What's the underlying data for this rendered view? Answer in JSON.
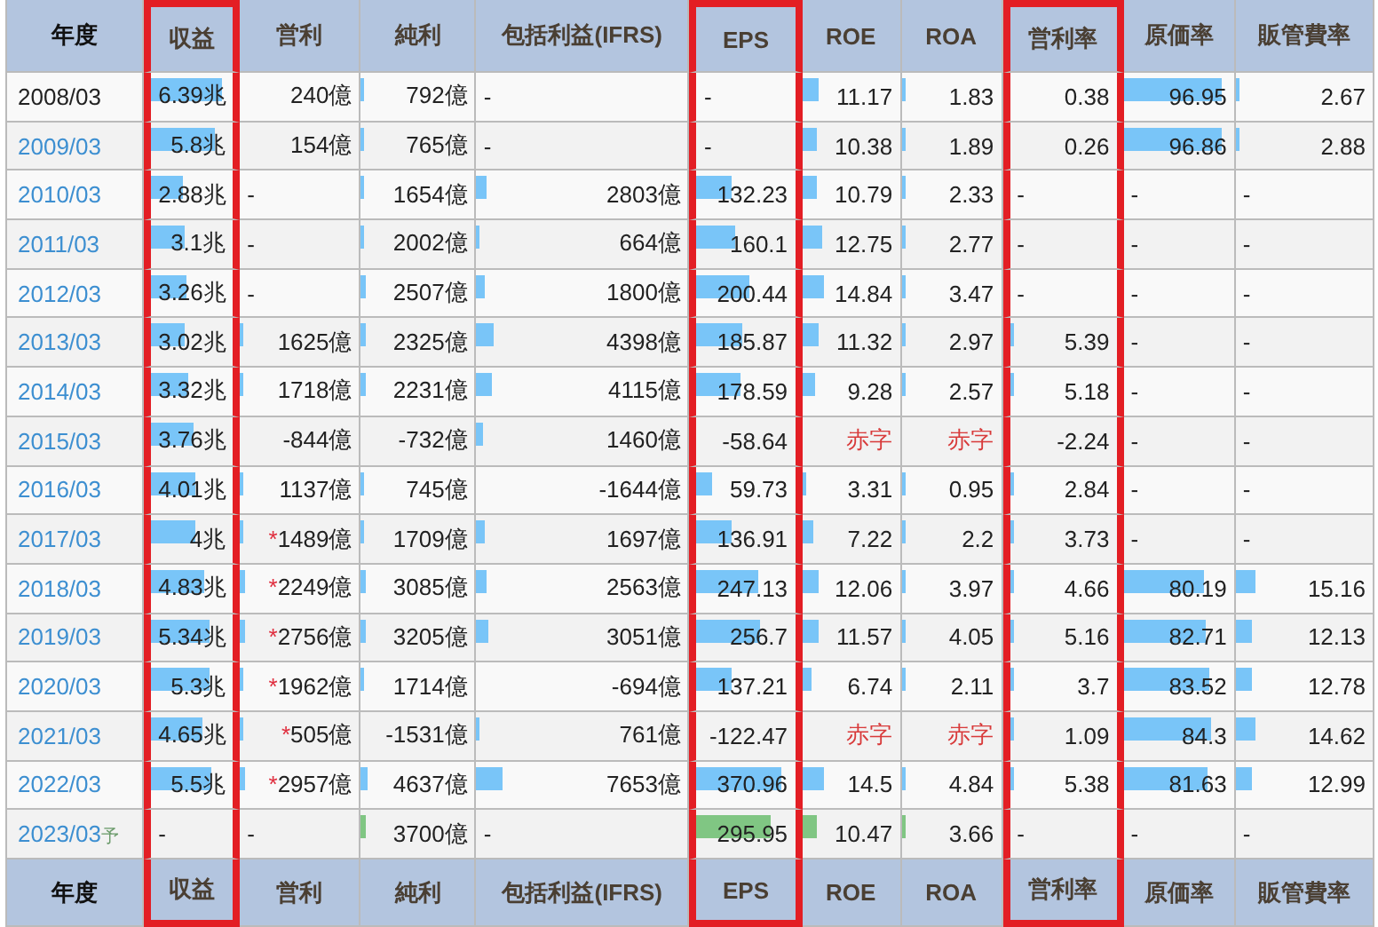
{
  "columns": [
    {
      "label": "年度",
      "highlighted": false
    },
    {
      "label": "収益",
      "highlighted": true
    },
    {
      "label": "営利",
      "highlighted": false
    },
    {
      "label": "純利",
      "highlighted": false
    },
    {
      "label": "包括利益(IFRS)",
      "highlighted": false
    },
    {
      "label": "EPS",
      "highlighted": true
    },
    {
      "label": "ROE",
      "highlighted": false
    },
    {
      "label": "ROA",
      "highlighted": false
    },
    {
      "label": "営利率",
      "highlighted": true
    },
    {
      "label": "原価率",
      "highlighted": false
    },
    {
      "label": "販管費率",
      "highlighted": false
    }
  ],
  "rows": [
    {
      "year": "2008/03",
      "link": false,
      "forecast": false,
      "cells": [
        {
          "kind": "value",
          "text": "6.39兆",
          "level": 0.86
        },
        {
          "kind": "value",
          "text": "240億"
        },
        {
          "kind": "value",
          "text": "792億",
          "level": 0.02
        },
        {
          "kind": "none",
          "text": "-"
        },
        {
          "kind": "none",
          "text": "-"
        },
        {
          "kind": "value",
          "text": "11.17",
          "level": 0.17
        },
        {
          "kind": "value",
          "text": "1.83",
          "level": 0.04
        },
        {
          "kind": "value",
          "text": "0.38"
        },
        {
          "kind": "value",
          "text": "96.95",
          "level": 0.89
        },
        {
          "kind": "value",
          "text": "2.67",
          "level": 0.03
        }
      ]
    },
    {
      "year": "2009/03",
      "link": true,
      "forecast": false,
      "cells": [
        {
          "kind": "value",
          "text": "5.8兆",
          "level": 0.78
        },
        {
          "kind": "value",
          "text": "154億"
        },
        {
          "kind": "value",
          "text": "765億",
          "level": 0.02
        },
        {
          "kind": "none",
          "text": "-"
        },
        {
          "kind": "none",
          "text": "-"
        },
        {
          "kind": "value",
          "text": "10.38",
          "level": 0.16
        },
        {
          "kind": "value",
          "text": "1.89",
          "level": 0.04
        },
        {
          "kind": "value",
          "text": "0.26"
        },
        {
          "kind": "value",
          "text": "96.86",
          "level": 0.89
        },
        {
          "kind": "value",
          "text": "2.88",
          "level": 0.03
        }
      ]
    },
    {
      "year": "2010/03",
      "link": true,
      "forecast": false,
      "cells": [
        {
          "kind": "value",
          "text": "2.88兆",
          "level": 0.39
        },
        {
          "kind": "none",
          "text": "-"
        },
        {
          "kind": "value",
          "text": "1654億",
          "level": 0.03
        },
        {
          "kind": "value",
          "text": "2803億",
          "level": 0.05
        },
        {
          "kind": "value",
          "text": "132.23",
          "level": 0.35
        },
        {
          "kind": "value",
          "text": "10.79",
          "level": 0.16
        },
        {
          "kind": "value",
          "text": "2.33",
          "level": 0.04
        },
        {
          "kind": "none",
          "text": "-"
        },
        {
          "kind": "none",
          "text": "-"
        },
        {
          "kind": "none",
          "text": "-"
        }
      ]
    },
    {
      "year": "2011/03",
      "link": true,
      "forecast": false,
      "cells": [
        {
          "kind": "value",
          "text": "3.1兆",
          "level": 0.42
        },
        {
          "kind": "none",
          "text": "-"
        },
        {
          "kind": "value",
          "text": "2002億",
          "level": 0.03
        },
        {
          "kind": "value",
          "text": "664億",
          "level": 0.01
        },
        {
          "kind": "value",
          "text": "160.1",
          "level": 0.4
        },
        {
          "kind": "value",
          "text": "12.75",
          "level": 0.2
        },
        {
          "kind": "value",
          "text": "2.77",
          "level": 0.04
        },
        {
          "kind": "none",
          "text": "-"
        },
        {
          "kind": "none",
          "text": "-"
        },
        {
          "kind": "none",
          "text": "-"
        }
      ]
    },
    {
      "year": "2012/03",
      "link": true,
      "forecast": false,
      "cells": [
        {
          "kind": "value",
          "text": "3.26兆",
          "level": 0.44
        },
        {
          "kind": "none",
          "text": "-"
        },
        {
          "kind": "value",
          "text": "2507億",
          "level": 0.04
        },
        {
          "kind": "value",
          "text": "1800億",
          "level": 0.04
        },
        {
          "kind": "value",
          "text": "200.44",
          "level": 0.53
        },
        {
          "kind": "value",
          "text": "14.84",
          "level": 0.23
        },
        {
          "kind": "value",
          "text": "3.47",
          "level": 0.04
        },
        {
          "kind": "none",
          "text": "-"
        },
        {
          "kind": "none",
          "text": "-"
        },
        {
          "kind": "none",
          "text": "-"
        }
      ]
    },
    {
      "year": "2013/03",
      "link": true,
      "forecast": false,
      "cells": [
        {
          "kind": "value",
          "text": "3.02兆",
          "level": 0.41
        },
        {
          "kind": "value",
          "text": "1625億",
          "level": 0.03
        },
        {
          "kind": "value",
          "text": "2325億",
          "level": 0.04
        },
        {
          "kind": "value",
          "text": "4398億",
          "level": 0.08
        },
        {
          "kind": "value",
          "text": "185.87",
          "level": 0.47
        },
        {
          "kind": "value",
          "text": "11.32",
          "level": 0.17
        },
        {
          "kind": "value",
          "text": "2.97",
          "level": 0.04
        },
        {
          "kind": "value",
          "text": "5.39",
          "level": 0.04
        },
        {
          "kind": "none",
          "text": "-"
        },
        {
          "kind": "none",
          "text": "-"
        }
      ]
    },
    {
      "year": "2014/03",
      "link": true,
      "forecast": false,
      "cells": [
        {
          "kind": "value",
          "text": "3.32兆",
          "level": 0.45
        },
        {
          "kind": "value",
          "text": "1718億",
          "level": 0.03
        },
        {
          "kind": "value",
          "text": "2231億",
          "level": 0.04
        },
        {
          "kind": "value",
          "text": "4115億",
          "level": 0.07
        },
        {
          "kind": "value",
          "text": "178.59",
          "level": 0.45
        },
        {
          "kind": "value",
          "text": "9.28",
          "level": 0.14
        },
        {
          "kind": "value",
          "text": "2.57",
          "level": 0.04
        },
        {
          "kind": "value",
          "text": "5.18",
          "level": 0.04
        },
        {
          "kind": "none",
          "text": "-"
        },
        {
          "kind": "none",
          "text": "-"
        }
      ]
    },
    {
      "year": "2015/03",
      "link": true,
      "forecast": false,
      "cells": [
        {
          "kind": "value",
          "text": "3.76兆",
          "level": 0.51
        },
        {
          "kind": "value",
          "text": "-844億"
        },
        {
          "kind": "value",
          "text": "-732億"
        },
        {
          "kind": "value",
          "text": "1460億",
          "level": 0.03
        },
        {
          "kind": "value",
          "text": "-58.64"
        },
        {
          "kind": "loss",
          "text": "赤字"
        },
        {
          "kind": "loss",
          "text": "赤字"
        },
        {
          "kind": "value",
          "text": "-2.24"
        },
        {
          "kind": "none",
          "text": "-"
        },
        {
          "kind": "none",
          "text": "-"
        }
      ]
    },
    {
      "year": "2016/03",
      "link": true,
      "forecast": false,
      "cells": [
        {
          "kind": "value",
          "text": "4.01兆",
          "level": 0.54
        },
        {
          "kind": "value",
          "text": "1137億",
          "level": 0.02
        },
        {
          "kind": "value",
          "text": "745億",
          "level": 0.02
        },
        {
          "kind": "value",
          "text": "-1644億"
        },
        {
          "kind": "value",
          "text": "59.73",
          "level": 0.15
        },
        {
          "kind": "value",
          "text": "3.31",
          "level": 0.05
        },
        {
          "kind": "value",
          "text": "0.95",
          "level": 0.02
        },
        {
          "kind": "value",
          "text": "2.84",
          "level": 0.04
        },
        {
          "kind": "none",
          "text": "-"
        },
        {
          "kind": "none",
          "text": "-"
        }
      ]
    },
    {
      "year": "2017/03",
      "link": true,
      "forecast": false,
      "cells": [
        {
          "kind": "value",
          "text": "4兆",
          "level": 0.54
        },
        {
          "kind": "value",
          "text": "1489億",
          "level": 0.03,
          "flag": "*"
        },
        {
          "kind": "value",
          "text": "1709億",
          "level": 0.03
        },
        {
          "kind": "value",
          "text": "1697億",
          "level": 0.04
        },
        {
          "kind": "value",
          "text": "136.91",
          "level": 0.35
        },
        {
          "kind": "value",
          "text": "7.22",
          "level": 0.11
        },
        {
          "kind": "value",
          "text": "2.2",
          "level": 0.04
        },
        {
          "kind": "value",
          "text": "3.73",
          "level": 0.04
        },
        {
          "kind": "none",
          "text": "-"
        },
        {
          "kind": "none",
          "text": "-"
        }
      ]
    },
    {
      "year": "2018/03",
      "link": true,
      "forecast": false,
      "cells": [
        {
          "kind": "value",
          "text": "4.83兆",
          "level": 0.65
        },
        {
          "kind": "value",
          "text": "2249億",
          "level": 0.04,
          "flag": "*"
        },
        {
          "kind": "value",
          "text": "3085億",
          "level": 0.05
        },
        {
          "kind": "value",
          "text": "2563億",
          "level": 0.05
        },
        {
          "kind": "value",
          "text": "247.13",
          "level": 0.63
        },
        {
          "kind": "value",
          "text": "12.06",
          "level": 0.18
        },
        {
          "kind": "value",
          "text": "3.97",
          "level": 0.04
        },
        {
          "kind": "value",
          "text": "4.66",
          "level": 0.04
        },
        {
          "kind": "value",
          "text": "80.19",
          "level": 0.73
        },
        {
          "kind": "value",
          "text": "15.16",
          "level": 0.14
        }
      ]
    },
    {
      "year": "2019/03",
      "link": true,
      "forecast": false,
      "cells": [
        {
          "kind": "value",
          "text": "5.34兆",
          "level": 0.72
        },
        {
          "kind": "value",
          "text": "2756億",
          "level": 0.04,
          "flag": "*"
        },
        {
          "kind": "value",
          "text": "3205億",
          "level": 0.05
        },
        {
          "kind": "value",
          "text": "3051億",
          "level": 0.06
        },
        {
          "kind": "value",
          "text": "256.7",
          "level": 0.65
        },
        {
          "kind": "value",
          "text": "11.57",
          "level": 0.18
        },
        {
          "kind": "value",
          "text": "4.05",
          "level": 0.04
        },
        {
          "kind": "value",
          "text": "5.16",
          "level": 0.04
        },
        {
          "kind": "value",
          "text": "82.71",
          "level": 0.75
        },
        {
          "kind": "value",
          "text": "12.13",
          "level": 0.12
        }
      ]
    },
    {
      "year": "2020/03",
      "link": true,
      "forecast": false,
      "cells": [
        {
          "kind": "value",
          "text": "5.3兆",
          "level": 0.72
        },
        {
          "kind": "value",
          "text": "1962億",
          "level": 0.03,
          "flag": "*"
        },
        {
          "kind": "value",
          "text": "1714億",
          "level": 0.03
        },
        {
          "kind": "value",
          "text": "-694億"
        },
        {
          "kind": "value",
          "text": "137.21",
          "level": 0.35
        },
        {
          "kind": "value",
          "text": "6.74",
          "level": 0.1
        },
        {
          "kind": "value",
          "text": "2.11",
          "level": 0.04
        },
        {
          "kind": "value",
          "text": "3.7",
          "level": 0.04
        },
        {
          "kind": "value",
          "text": "83.52",
          "level": 0.77
        },
        {
          "kind": "value",
          "text": "12.78",
          "level": 0.12
        }
      ]
    },
    {
      "year": "2021/03",
      "link": true,
      "forecast": false,
      "cells": [
        {
          "kind": "value",
          "text": "4.65兆",
          "level": 0.63
        },
        {
          "kind": "value",
          "text": "505億",
          "level": 0.01,
          "flag": "*"
        },
        {
          "kind": "value",
          "text": "-1531億"
        },
        {
          "kind": "value",
          "text": "761億",
          "level": 0.01
        },
        {
          "kind": "value",
          "text": "-122.47"
        },
        {
          "kind": "loss",
          "text": "赤字"
        },
        {
          "kind": "loss",
          "text": "赤字"
        },
        {
          "kind": "value",
          "text": "1.09",
          "level": 0.01
        },
        {
          "kind": "value",
          "text": "84.3",
          "level": 0.8
        },
        {
          "kind": "value",
          "text": "14.62",
          "level": 0.14
        }
      ]
    },
    {
      "year": "2022/03",
      "link": true,
      "forecast": false,
      "cells": [
        {
          "kind": "value",
          "text": "5.5兆",
          "level": 0.74
        },
        {
          "kind": "value",
          "text": "2957億",
          "level": 0.04,
          "flag": "*"
        },
        {
          "kind": "value",
          "text": "4637億",
          "level": 0.06
        },
        {
          "kind": "value",
          "text": "7653億",
          "level": 0.12
        },
        {
          "kind": "value",
          "text": "370.96",
          "level": 0.87
        },
        {
          "kind": "value",
          "text": "14.5",
          "level": 0.22
        },
        {
          "kind": "value",
          "text": "4.84",
          "level": 0.04
        },
        {
          "kind": "value",
          "text": "5.38",
          "level": 0.04
        },
        {
          "kind": "value",
          "text": "81.63",
          "level": 0.76
        },
        {
          "kind": "value",
          "text": "12.99",
          "level": 0.12
        }
      ]
    },
    {
      "year": "2023/03",
      "link": true,
      "forecast": true,
      "suffix": "予",
      "cells": [
        {
          "kind": "none",
          "text": "-"
        },
        {
          "kind": "none",
          "text": "-"
        },
        {
          "kind": "value",
          "text": "3700億",
          "level": 0.04
        },
        {
          "kind": "none",
          "text": "-"
        },
        {
          "kind": "value",
          "text": "295.95",
          "level": 0.75
        },
        {
          "kind": "value",
          "text": "10.47",
          "level": 0.16
        },
        {
          "kind": "value",
          "text": "3.66",
          "level": 0.04
        },
        {
          "kind": "none",
          "text": "-"
        },
        {
          "kind": "none",
          "text": "-"
        },
        {
          "kind": "none",
          "text": "-"
        }
      ]
    }
  ],
  "footer": [
    "年度",
    "収益",
    "営利",
    "純利",
    "包括利益(IFRS)",
    "EPS",
    "ROE",
    "ROA",
    "営利率",
    "原価率",
    "販管費率"
  ]
}
